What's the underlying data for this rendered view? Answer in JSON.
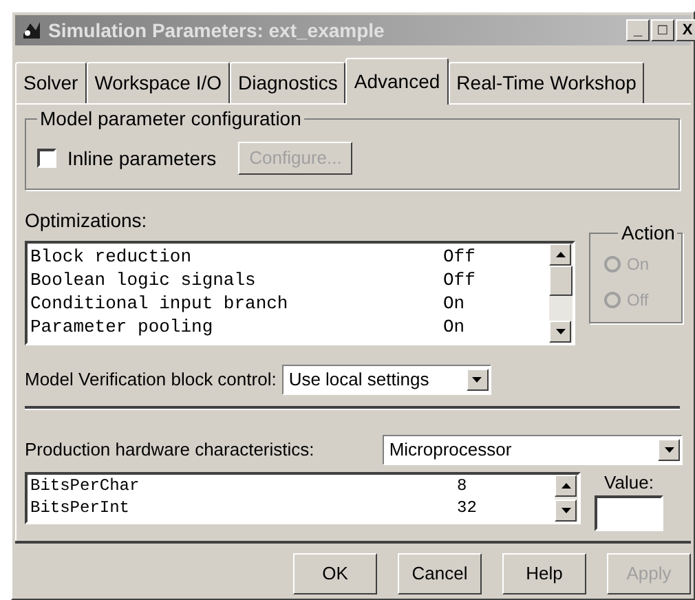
{
  "window": {
    "title": "Simulation Parameters: ext_example",
    "controls": [
      "_",
      "□",
      "X"
    ]
  },
  "tabs": [
    {
      "label": "Solver",
      "selected": false
    },
    {
      "label": "Workspace I/O",
      "selected": false
    },
    {
      "label": "Diagnostics",
      "selected": false
    },
    {
      "label": "Advanced",
      "selected": true
    },
    {
      "label": "Real-Time Workshop",
      "selected": false
    }
  ],
  "model_parameter_configuration": {
    "title": "Model parameter configuration",
    "inline_parameters": {
      "label": "Inline parameters",
      "checked": false
    },
    "configure_button": {
      "label": "Configure...",
      "disabled": true
    }
  },
  "optimizations": {
    "label": "Optimizations:",
    "rows": [
      {
        "name": "Block reduction",
        "value": "Off"
      },
      {
        "name": "Boolean logic signals",
        "value": "Off"
      },
      {
        "name": "Conditional input branch",
        "value": "On"
      },
      {
        "name": "Parameter pooling",
        "value": "On"
      }
    ]
  },
  "action": {
    "title": "Action",
    "options": [
      {
        "label": "On",
        "selected": false,
        "disabled": true
      },
      {
        "label": "Off",
        "selected": false,
        "disabled": true
      }
    ]
  },
  "model_verification": {
    "label": "Model Verification block control:",
    "value": "Use local settings"
  },
  "production_hardware": {
    "label": "Production hardware characteristics:",
    "value": "Microprocessor",
    "rows": [
      {
        "name": "BitsPerChar",
        "value": "8"
      },
      {
        "name": "BitsPerInt",
        "value": "32"
      }
    ],
    "value_label": "Value:"
  },
  "buttons": [
    {
      "label": "OK",
      "disabled": false
    },
    {
      "label": "Cancel",
      "disabled": false
    },
    {
      "label": "Help",
      "disabled": false
    },
    {
      "label": "Apply",
      "disabled": true
    }
  ]
}
